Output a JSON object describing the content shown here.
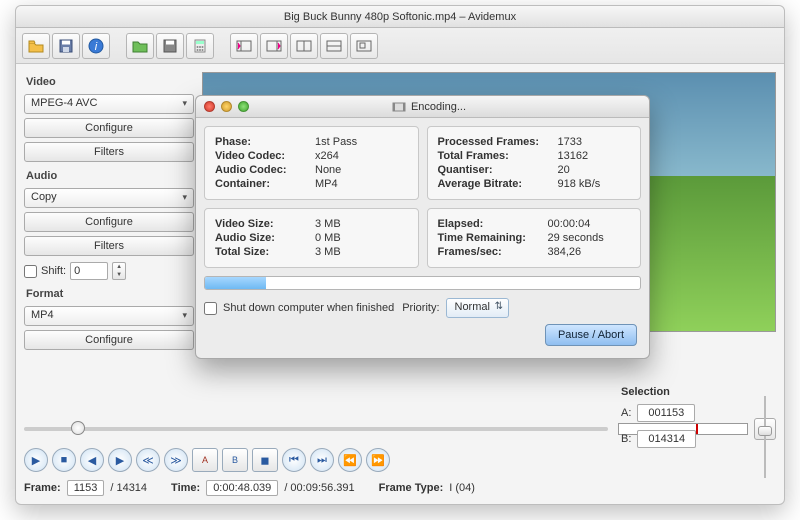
{
  "window": {
    "title": "Big Buck Bunny 480p Softonic.mp4 – Avidemux"
  },
  "sidebar": {
    "video_label": "Video",
    "video_codec": "MPEG-4 AVC",
    "configure": "Configure",
    "filters": "Filters",
    "audio_label": "Audio",
    "audio_mode": "Copy",
    "shift_label": "Shift:",
    "shift_value": "0",
    "format_label": "Format",
    "format_value": "MP4"
  },
  "encoding": {
    "title": "Encoding...",
    "left1": {
      "phase_k": "Phase:",
      "phase_v": "1st Pass",
      "vcodec_k": "Video Codec:",
      "vcodec_v": "x264",
      "acodec_k": "Audio Codec:",
      "acodec_v": "None",
      "cont_k": "Container:",
      "cont_v": "MP4"
    },
    "right1": {
      "pf_k": "Processed Frames:",
      "pf_v": "1733",
      "tf_k": "Total Frames:",
      "tf_v": "13162",
      "q_k": "Quantiser:",
      "q_v": "20",
      "ab_k": "Average Bitrate:",
      "ab_v": "918 kB/s"
    },
    "left2": {
      "vs_k": "Video Size:",
      "vs_v": "3 MB",
      "as_k": "Audio Size:",
      "as_v": "0 MB",
      "ts_k": "Total Size:",
      "ts_v": "3 MB"
    },
    "right2": {
      "el_k": "Elapsed:",
      "el_v": "00:00:04",
      "tr_k": "Time Remaining:",
      "tr_v": "29 seconds",
      "fps_k": "Frames/sec:",
      "fps_v": "384,26"
    },
    "shutdown_label": "Shut down computer when finished",
    "priority_label": "Priority:",
    "priority_value": "Normal",
    "pause_label": "Pause / Abort"
  },
  "status": {
    "frame_label": "Frame:",
    "frame_value": "1153",
    "frame_total": "/ 14314",
    "time_label": "Time:",
    "time_value": "0:00:48.039",
    "time_total": "/ 00:09:56.391",
    "type_label": "Frame Type:",
    "type_value": "I (04)"
  },
  "selection": {
    "label": "Selection",
    "a_label": "A:",
    "a_value": "001153",
    "b_label": "B:",
    "b_value": "014314"
  },
  "seek": {
    "thumb_percent": 8
  }
}
